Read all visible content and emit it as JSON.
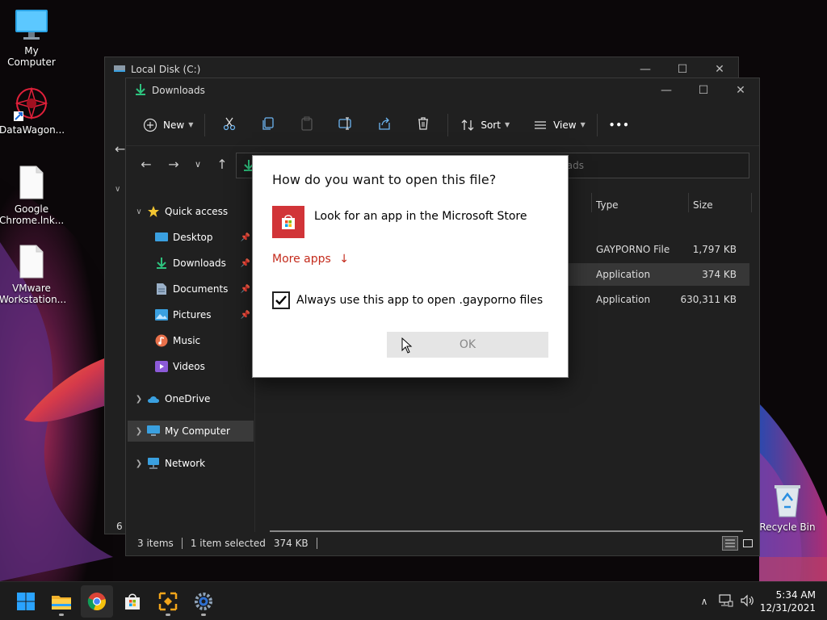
{
  "desktop": {
    "icons": [
      {
        "label": "My Computer",
        "icon": "monitor-icon"
      },
      {
        "label": "DataWagon...",
        "icon": "datawagon-icon"
      },
      {
        "label": "Google Chrome.lnk...",
        "icon": "file-icon"
      },
      {
        "label": "VMware Workstation...",
        "icon": "file-icon"
      },
      {
        "label": "Recycle Bin",
        "icon": "recycle-bin-icon"
      }
    ]
  },
  "back_window": {
    "title": "Local Disk (C:)",
    "status_partial": "6 i"
  },
  "explorer": {
    "title": "Downloads",
    "toolbar": {
      "new_label": "New",
      "sort_label": "Sort",
      "view_label": "View",
      "more_label": "•••"
    },
    "address_hint": "ads",
    "sidebar": {
      "quick_access": "Quick access",
      "items": [
        {
          "label": "Desktop",
          "icon": "desktop-icon"
        },
        {
          "label": "Downloads",
          "icon": "download-icon"
        },
        {
          "label": "Documents",
          "icon": "documents-icon"
        },
        {
          "label": "Pictures",
          "icon": "pictures-icon"
        },
        {
          "label": "Music",
          "icon": "music-icon"
        },
        {
          "label": "Videos",
          "icon": "videos-icon"
        }
      ],
      "onedrive": "OneDrive",
      "my_computer": "My Computer",
      "network": "Network"
    },
    "columns": {
      "type": "Type",
      "size": "Size"
    },
    "files": [
      {
        "type": "GAYPORNO File",
        "size": "1,797 KB"
      },
      {
        "type": "Application",
        "size": "374 KB"
      },
      {
        "type": "Application",
        "size": "630,311 KB"
      }
    ],
    "status": {
      "items": "3 items",
      "selected": "1 item selected",
      "size": "374 KB"
    }
  },
  "dialog": {
    "question": "How do you want to open this file?",
    "store_option": "Look for an app in the Microsoft Store",
    "more_apps": "More apps",
    "always_use": "Always use this app to open .gayporno files",
    "always_checked": true,
    "ok": "OK"
  },
  "taskbar": {
    "apps": [
      "start-icon",
      "file-explorer-icon",
      "chrome-icon",
      "store-icon",
      "network-tool-icon",
      "settings-icon"
    ],
    "time": "5:34 AM",
    "date": "12/31/2021"
  },
  "colors": {
    "accent_red": "#c42b1c",
    "store_red": "#d13438",
    "window_bg": "#202020"
  }
}
